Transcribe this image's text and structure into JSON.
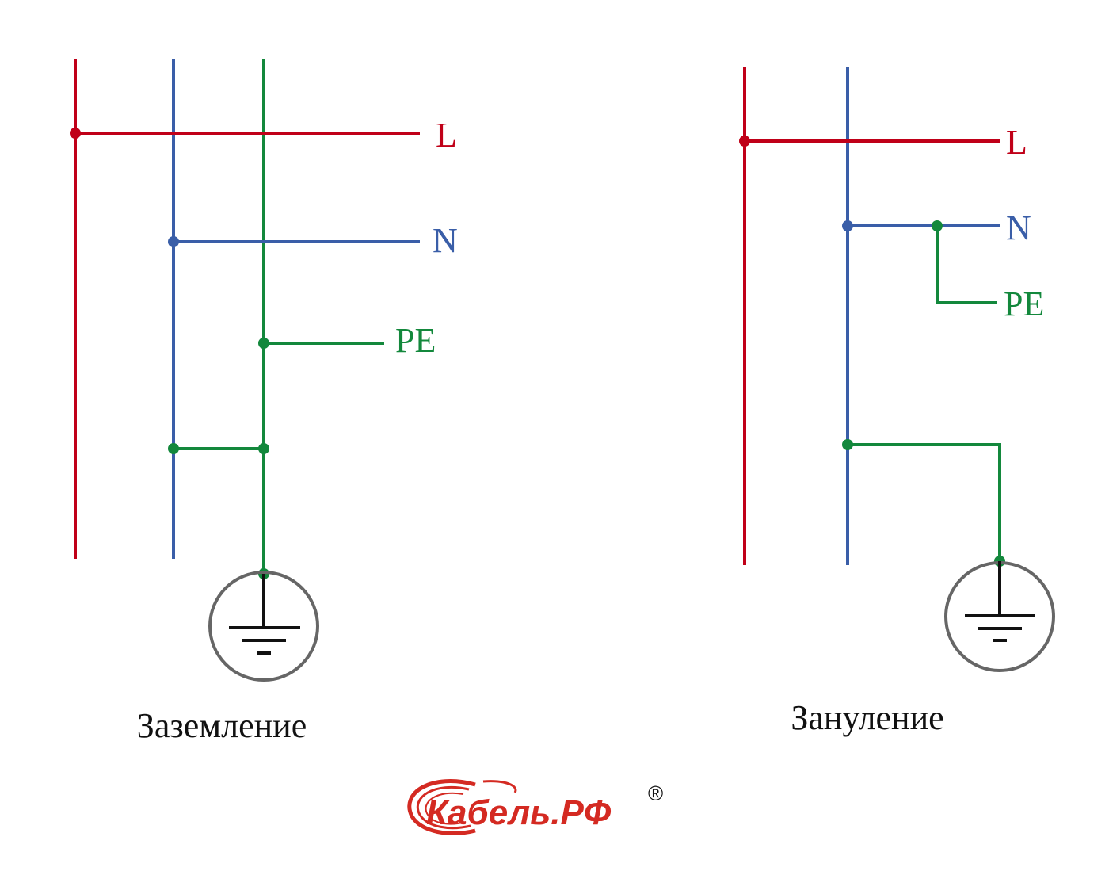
{
  "colors": {
    "phase": "#c00018",
    "neutral": "#3a5ea8",
    "protective_earth": "#13883c",
    "ground_symbol": "#666666",
    "ground_bars": "#111111",
    "caption": "#111111",
    "logo": "#d42a22"
  },
  "left_diagram": {
    "labels": {
      "l": "L",
      "n": "N",
      "pe": "PE"
    },
    "caption": "Заземление"
  },
  "right_diagram": {
    "labels": {
      "l": "L",
      "n": "N",
      "pe": "PE"
    },
    "caption": "Зануление"
  },
  "logo": {
    "text": "Кабель.РФ",
    "registered": "®",
    "icon": "swoosh-logo-mark"
  }
}
